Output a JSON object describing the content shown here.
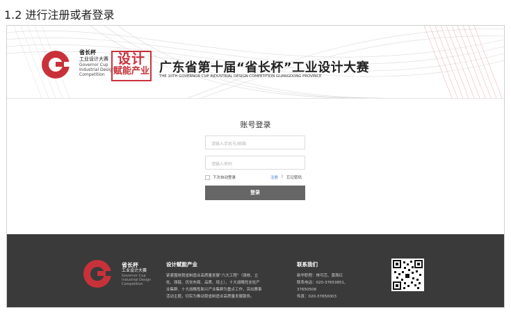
{
  "doc": {
    "heading": "1.2 进行注册或者登录"
  },
  "banner": {
    "cup_cn": "省长杯",
    "cup_cn2": "工业设计大赛",
    "cup_en1": "Governor Cup",
    "cup_en2": "Industrial Design",
    "cup_en3": "Competition",
    "slogan_line1": "设计",
    "slogan_line2": "赋能产业",
    "title": "广东省第十届“省长杯”工业设计大赛",
    "subtitle": "THE 10TH GOVERNOR CUP INDUSTRIAL DESIGN COMPETITION GUANGDONG PROVINCE"
  },
  "login": {
    "title": "账号登录",
    "username_placeholder": "请输入手机号/邮箱",
    "password_placeholder": "请输入密码",
    "auto_login": "下次自动登录",
    "register": "注册",
    "separator": "|",
    "forgot": "忘记密码",
    "submit": "登录"
  },
  "footer": {
    "cup_cn": "省长杯",
    "cup_cn2": "工业设计大赛",
    "cup_en1": "Governor Cup",
    "cup_en2": "Industrial Design",
    "cup_en3": "Competition",
    "col1_title": "设计赋能产业",
    "col1_lines": [
      "紧紧围绕我省制造业高质量发展“六大工程”（强核、立",
      "柱、强链、优化布局、品质、培土），十大战略性支柱产",
      "业集群、十大战略性新兴产业集群为重点工作，突出赛事",
      "活动主题，切实为推动我省制造业高质量发展服务。"
    ],
    "col2_title": "联系我们",
    "col2_lines": [
      "新华职程：林可芯、黄燕红",
      "联系电话：020-37653851、",
      "37650508",
      "传真：020-37650003"
    ]
  },
  "colors": {
    "brand_red": "#c9313a",
    "footer_bg": "#3a3a3a",
    "button": "#666666",
    "link": "#3a7bd5"
  }
}
